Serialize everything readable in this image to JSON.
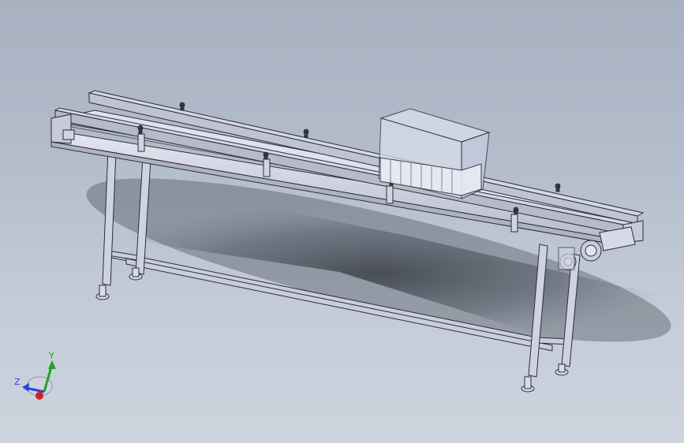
{
  "viewport": {
    "background_top": "#a7b1c0",
    "background_bottom": "#cdd4de"
  },
  "model": {
    "frame_color": "#c9cddc",
    "edge_color": "#2a2d36",
    "glass_color": "#d6dcec"
  },
  "triad": {
    "y_label": "Y",
    "z_label": "Z",
    "y_color": "#1fa51f",
    "z_color": "#2248d6",
    "x_color": "#d21f1f"
  }
}
